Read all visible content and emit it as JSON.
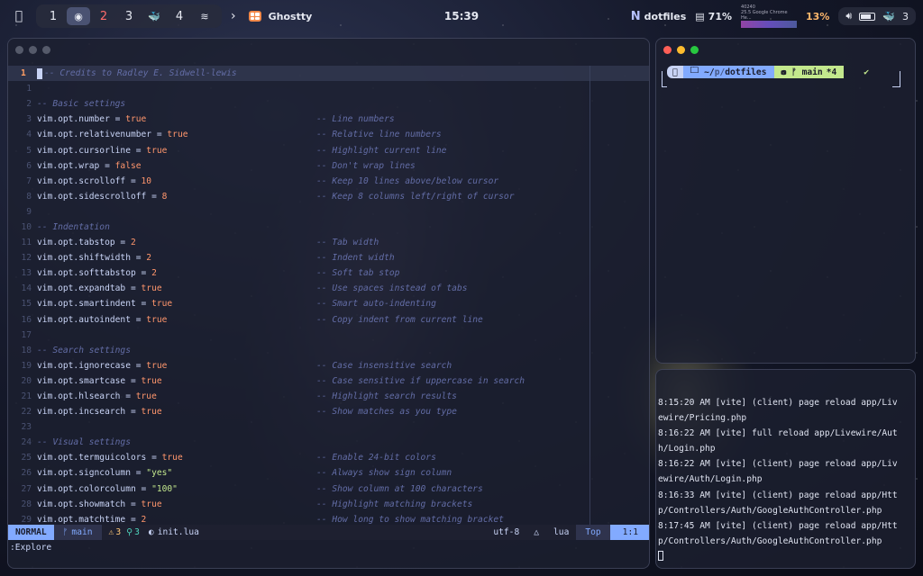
{
  "menubar": {
    "spaces": [
      "1",
      "2",
      "3",
      "4"
    ],
    "app_name": "Ghostty",
    "clock": "15:39",
    "repo": "dotfiles",
    "cpu_percent": "71%",
    "net_info": "40240",
    "chrome_info": "25.5 Google Chrome He...",
    "chrome_percent": "13%",
    "notif_count": "3"
  },
  "editor": {
    "lines": [
      {
        "n": "1",
        "code": "",
        "val": "",
        "cmt": "-- Credits to Radley E. Sidwell-lewis",
        "cur": true
      },
      {
        "n": "1",
        "code": "",
        "val": "",
        "cmt": ""
      },
      {
        "n": "2",
        "code": "",
        "val": "",
        "cmt": "-- Basic settings"
      },
      {
        "n": "3",
        "code": "vim.opt.number = ",
        "val": "true",
        "cmt": "-- Line numbers"
      },
      {
        "n": "4",
        "code": "vim.opt.relativenumber = ",
        "val": "true",
        "cmt": "-- Relative line numbers"
      },
      {
        "n": "5",
        "code": "vim.opt.cursorline = ",
        "val": "true",
        "cmt": "-- Highlight current line"
      },
      {
        "n": "6",
        "code": "vim.opt.wrap = ",
        "val": "false",
        "cmt": "-- Don't wrap lines"
      },
      {
        "n": "7",
        "code": "vim.opt.scrolloff = ",
        "val": "10",
        "cmt": "-- Keep 10 lines above/below cursor"
      },
      {
        "n": "8",
        "code": "vim.opt.sidescrolloff = ",
        "val": "8",
        "cmt": "-- Keep 8 columns left/right of cursor"
      },
      {
        "n": "9",
        "code": "",
        "val": "",
        "cmt": ""
      },
      {
        "n": "10",
        "code": "",
        "val": "",
        "cmt": "-- Indentation"
      },
      {
        "n": "11",
        "code": "vim.opt.tabstop = ",
        "val": "2",
        "cmt": "-- Tab width"
      },
      {
        "n": "12",
        "code": "vim.opt.shiftwidth = ",
        "val": "2",
        "cmt": "-- Indent width"
      },
      {
        "n": "13",
        "code": "vim.opt.softtabstop = ",
        "val": "2",
        "cmt": "-- Soft tab stop"
      },
      {
        "n": "14",
        "code": "vim.opt.expandtab = ",
        "val": "true",
        "cmt": "-- Use spaces instead of tabs"
      },
      {
        "n": "15",
        "code": "vim.opt.smartindent = ",
        "val": "true",
        "cmt": "-- Smart auto-indenting"
      },
      {
        "n": "16",
        "code": "vim.opt.autoindent = ",
        "val": "true",
        "cmt": "-- Copy indent from current line"
      },
      {
        "n": "17",
        "code": "",
        "val": "",
        "cmt": ""
      },
      {
        "n": "18",
        "code": "",
        "val": "",
        "cmt": "-- Search settings"
      },
      {
        "n": "19",
        "code": "vim.opt.ignorecase = ",
        "val": "true",
        "cmt": "-- Case insensitive search"
      },
      {
        "n": "20",
        "code": "vim.opt.smartcase = ",
        "val": "true",
        "cmt": "-- Case sensitive if uppercase in search"
      },
      {
        "n": "21",
        "code": "vim.opt.hlsearch = ",
        "val": "true",
        "cmt": "-- Highlight search results"
      },
      {
        "n": "22",
        "code": "vim.opt.incsearch = ",
        "val": "true",
        "cmt": "-- Show matches as you type"
      },
      {
        "n": "23",
        "code": "",
        "val": "",
        "cmt": ""
      },
      {
        "n": "24",
        "code": "",
        "val": "",
        "cmt": "-- Visual settings"
      },
      {
        "n": "25",
        "code": "vim.opt.termguicolors = ",
        "val": "true",
        "cmt": "-- Enable 24-bit colors"
      },
      {
        "n": "26",
        "code": "vim.opt.signcolumn = ",
        "val": "\"yes\"",
        "cmt": "-- Always show sign column"
      },
      {
        "n": "27",
        "code": "vim.opt.colorcolumn = ",
        "val": "\"100\"",
        "cmt": "-- Show column at 100 characters"
      },
      {
        "n": "28",
        "code": "vim.opt.showmatch = ",
        "val": "true",
        "cmt": "-- Highlight matching brackets"
      },
      {
        "n": "29",
        "code": "vim.opt.matchtime = ",
        "val": "2",
        "cmt": "-- How long to show matching bracket"
      }
    ],
    "statusline": {
      "mode": "NORMAL",
      "branch": "main",
      "warnings": "3",
      "hints": "3",
      "filename": "init.lua",
      "encoding": "utf-8",
      "filetype": "lua",
      "position": "Top",
      "location": "1:1"
    },
    "cmdline": ":Explore"
  },
  "terminal_top": {
    "path_home": "~/",
    "path_sep": "p/",
    "dir": "dotfiles",
    "git_branch": "main",
    "git_status": "*4",
    "check": "✔"
  },
  "terminal_bottom": {
    "log_lines": [
      "8:15:20 AM [vite] (client) page reload app/Liv",
      "ewire/Pricing.php",
      "8:16:22 AM [vite] full reload app/Livewire/Aut",
      "h/Login.php",
      "8:16:22 AM [vite] (client) page reload app/Liv",
      "ewire/Auth/Login.php",
      "8:16:33 AM [vite] (client) page reload app/Htt",
      "p/Controllers/Auth/GoogleAuthController.php",
      "8:17:45 AM [vite] (client) page reload app/Htt",
      "p/Controllers/Auth/GoogleAuthController.php"
    ]
  }
}
